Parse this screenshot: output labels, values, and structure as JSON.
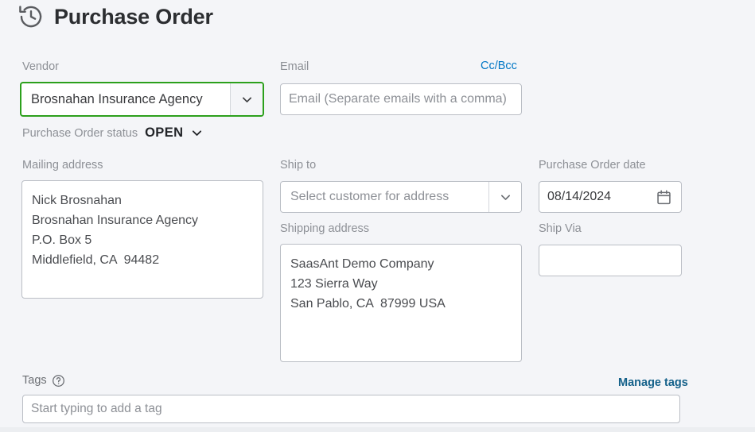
{
  "header": {
    "title": "Purchase Order",
    "icon": "history-clock-icon"
  },
  "vendor": {
    "label": "Vendor",
    "value": "Brosnahan Insurance Agency",
    "dropdown_icon": "chevron-down-icon"
  },
  "status": {
    "label": "Purchase Order status",
    "value": "OPEN",
    "dropdown_icon": "chevron-down-icon"
  },
  "email": {
    "label": "Email",
    "placeholder": "Email (Separate emails with a comma)",
    "cc_bcc_label": "Cc/Bcc"
  },
  "mailing_address": {
    "label": "Mailing address",
    "lines": [
      "Nick Brosnahan",
      "Brosnahan Insurance Agency",
      "P.O. Box 5",
      "Middlefield, CA  94482"
    ]
  },
  "ship_to": {
    "label": "Ship to",
    "placeholder": "Select customer for address",
    "dropdown_icon": "chevron-down-icon"
  },
  "shipping_address": {
    "label": "Shipping address",
    "lines": [
      "SaasAnt Demo Company",
      "123 Sierra Way",
      "San Pablo, CA  87999 USA"
    ]
  },
  "purchase_order_date": {
    "label": "Purchase Order date",
    "value": "08/14/2024",
    "icon": "calendar-icon"
  },
  "ship_via": {
    "label": "Ship Via",
    "value": ""
  },
  "tags": {
    "label": "Tags",
    "help_icon": "question-circle-icon",
    "placeholder": "Start typing to add a tag",
    "manage_label": "Manage tags"
  },
  "colors": {
    "background": "#f4f5f8",
    "focus_green": "#2ca01c",
    "link_blue": "#0077c5",
    "link_dark_teal": "#14618a",
    "text": "#393a3d",
    "label_gray": "#8d9096",
    "border_gray": "#babec5"
  }
}
